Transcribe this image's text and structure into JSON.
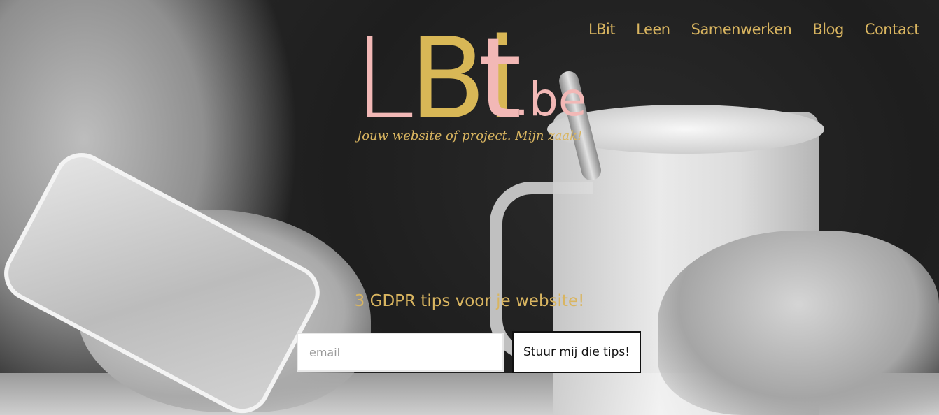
{
  "nav": {
    "items": [
      {
        "label": "LBit"
      },
      {
        "label": "Leen"
      },
      {
        "label": "Samenwerken"
      },
      {
        "label": "Blog"
      },
      {
        "label": "Contact"
      }
    ]
  },
  "logo": {
    "part_l": "L",
    "part_bi": "Bi",
    "part_t": "t",
    "part_domain": ".be",
    "tagline": "Jouw website of project. Mijn zaak!"
  },
  "signup": {
    "heading": "3 GDPR tips voor je website!",
    "email_placeholder": "email",
    "button_label": "Stuur mij die tips!"
  },
  "colors": {
    "gold": "#d9b560",
    "pink": "#f2b8b6"
  }
}
